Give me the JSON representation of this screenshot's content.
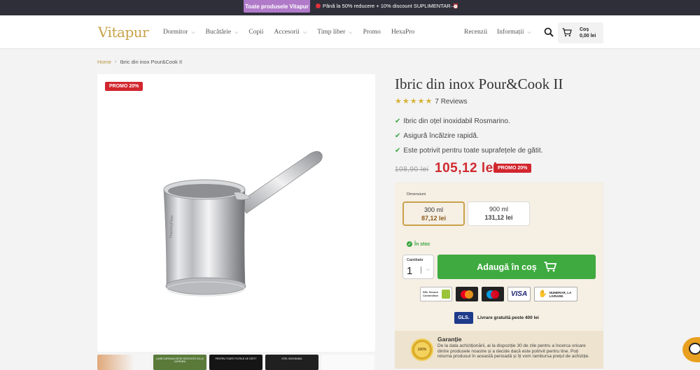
{
  "topbar": {
    "pill": "Toate produsele Vitapur",
    "message": "Până la 50% reducere + 10% discount SUPLIMENTAR",
    "arrow_icon": "arrow-right-icon"
  },
  "header": {
    "logo": "Vitapur",
    "nav": [
      {
        "label": "Dormitor",
        "dropdown": true
      },
      {
        "label": "Bucătărie",
        "dropdown": true
      },
      {
        "label": "Copii",
        "dropdown": false
      },
      {
        "label": "Accesorii",
        "dropdown": true
      },
      {
        "label": "Timp liber",
        "dropdown": true
      },
      {
        "label": "Promo",
        "dropdown": false
      },
      {
        "label": "HexaPro",
        "dropdown": false
      }
    ],
    "right_nav": {
      "reviews": "Recenzii",
      "info": "Informații"
    },
    "cart": {
      "label": "Coș",
      "total": "0,00 lei"
    }
  },
  "breadcrumb": {
    "home": "Home",
    "separator": "›",
    "current": "Ibric din inox Pour&Cook II"
  },
  "gallery": {
    "promo_badge": "PROMO 20%",
    "thumbs": [
      {
        "text": ""
      },
      {
        "text": "LASĂ CAFEAUA SĂ SE DEZVOLTE CA LA CAFENEA"
      },
      {
        "text": "PENTRU TOATE PLITELE DE GĂTIT"
      },
      {
        "text": "OȚEL INOXIDABIL"
      },
      {
        "text": ""
      }
    ]
  },
  "product": {
    "title": "Ibric din inox Pour&Cook II",
    "rating": 5,
    "reviews": "7 Reviews",
    "features": [
      "Ibric din oțel inoxidabil Rosmarino.",
      "Asigură încălzire rapidă.",
      "Este potrivit pentru toate suprafețele de gătit."
    ],
    "old_price": "108,90 lei",
    "new_price": "105,12 lei",
    "price_badge": "PROMO 20%"
  },
  "options": {
    "label": "Dimensiuni",
    "items": [
      {
        "volume": "300 ml",
        "price": "87,12 lei",
        "selected": true
      },
      {
        "volume": "900 ml",
        "price": "131,12 lei",
        "selected": false
      }
    ],
    "stock": "În stoc",
    "quantity_label": "Cantitate",
    "quantity": "1",
    "add_button": "Adaugă în coș",
    "payment_badges": {
      "ssl": "SSL Secure Connection",
      "cod": "NUMERAR, LA LIVRARE",
      "visa": "VISA"
    },
    "shipping": {
      "carrier": "GLS.",
      "text": "Livrare gratuită peste 400 lei"
    },
    "guarantee": {
      "title": "Garanție",
      "text": "De la data achiziționării, ai la dispoziție 30 de zile pentru a încerca oricare dintre produsele noastre și a decide dacă este potrivit pentru tine. Poți returna produsul în această perioadă și îți vom rambursa prețul de achiziție.",
      "medal": "100%"
    }
  },
  "colors": {
    "accent": "#c9a24a",
    "sale": "#d02a30",
    "cta": "#3eaa3f",
    "topbar": "#2f2f3a",
    "pill": "#b07ac9"
  }
}
